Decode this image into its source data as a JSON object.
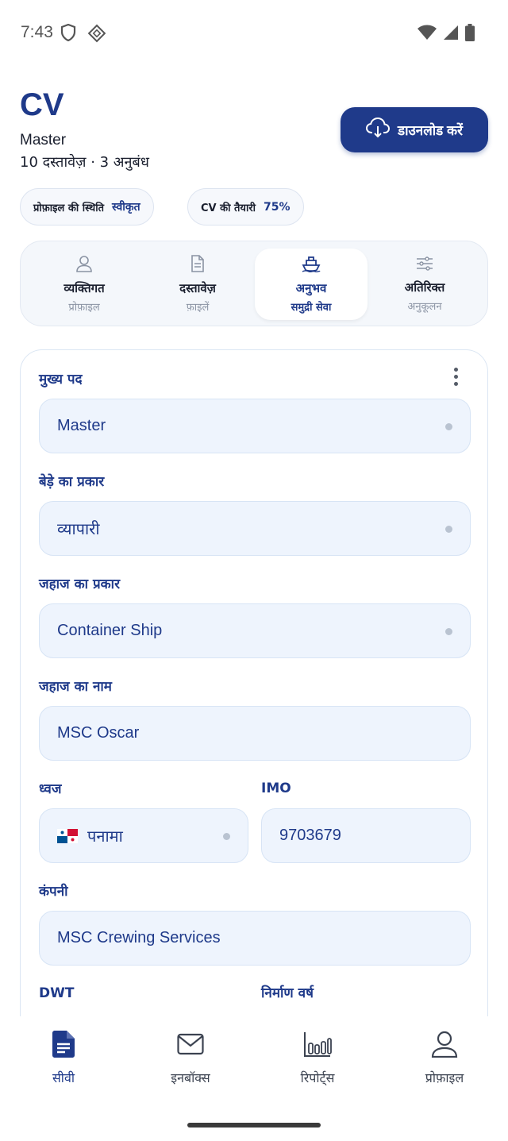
{
  "status": {
    "time": "7:43"
  },
  "header": {
    "title": "CV",
    "subtitle": "Master",
    "meta": "10 दस्तावेज़ · 3 अनुबंध",
    "download_label": "डाउनलोड करें"
  },
  "chips": [
    {
      "key": "प्रोफ़ाइल की स्थिति",
      "value": "स्वीकृत"
    },
    {
      "key": "CV की तैयारी",
      "value": "75%"
    }
  ],
  "tabs": [
    {
      "label": "व्यक्तिगत",
      "sub": "प्रोफ़ाइल",
      "icon": "user-icon"
    },
    {
      "label": "दस्तावेज़",
      "sub": "फ़ाइलें",
      "icon": "document-icon"
    },
    {
      "label": "अनुभव",
      "sub": "समुद्री सेवा",
      "icon": "ship-icon",
      "active": true
    },
    {
      "label": "अतिरिक्त",
      "sub": "अनुकूलन",
      "icon": "sliders-icon"
    }
  ],
  "form": {
    "position_label": "मुख्य पद",
    "position_value": "Master",
    "fleet_label": "बेड़े का प्रकार",
    "fleet_value": "व्यापारी",
    "vessel_type_label": "जहाज का प्रकार",
    "vessel_type_value": "Container Ship",
    "vessel_name_label": "जहाज का नाम",
    "vessel_name_value": "MSC Oscar",
    "flag_label": "ध्वज",
    "flag_value": "पनामा",
    "imo_label": "IMO",
    "imo_value": "9703679",
    "company_label": "कंपनी",
    "company_value": "MSC Crewing Services",
    "dwt_label": "DWT",
    "built_label": "निर्माण वर्ष"
  },
  "nav": [
    {
      "label": "सीवी",
      "icon": "cv-document-icon",
      "active": true
    },
    {
      "label": "इनबॉक्स",
      "icon": "mail-icon"
    },
    {
      "label": "रिपोर्ट्स",
      "icon": "bar-chart-icon"
    },
    {
      "label": "प्रोफ़ाइल",
      "icon": "profile-icon"
    }
  ],
  "colors": {
    "primary": "#1f3a8a",
    "field_bg": "#eef4fd",
    "text": "#1a1f2e"
  }
}
